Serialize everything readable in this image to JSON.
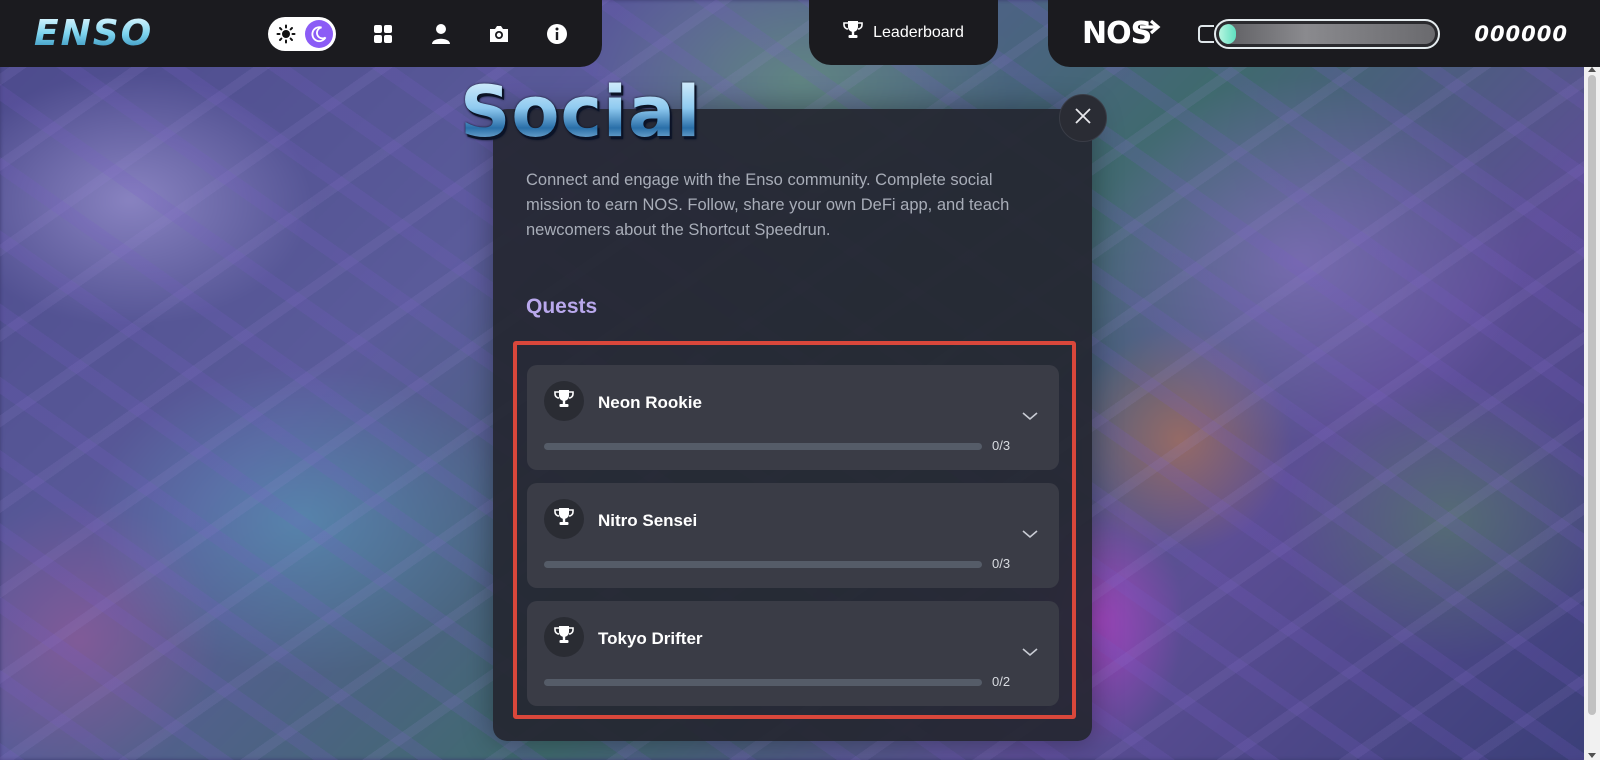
{
  "header": {
    "logo_text": "ENSO",
    "theme_toggle": {
      "light_icon": "sun-icon",
      "dark_icon": "moon-icon",
      "active": "dark"
    },
    "nav_icons": [
      "grid-icon",
      "user-icon",
      "camera-icon",
      "info-icon"
    ],
    "leaderboard_label": "Leaderboard",
    "nos_logo_text": "NOS",
    "nitro_level": 0.08,
    "score": "000000"
  },
  "modal": {
    "title": "Social",
    "description": "Connect and engage with the Enso community. Complete social mission to earn NOS. Follow, share your own DeFi app, and teach newcomers about the Shortcut Speedrun.",
    "quests_heading": "Quests",
    "quests": [
      {
        "name": "Neon Rookie",
        "progress": "0/3",
        "fraction": 0
      },
      {
        "name": "Nitro Sensei",
        "progress": "0/3",
        "fraction": 0
      },
      {
        "name": "Tokyo Drifter",
        "progress": "0/2",
        "fraction": 0
      }
    ]
  },
  "colors": {
    "topbar": "#1b1b1f",
    "modal": "#24262f",
    "quests_heading": "#b9a8ec",
    "highlight_outline": "#d9473b",
    "moon_toggle": "#8b5cf6"
  }
}
